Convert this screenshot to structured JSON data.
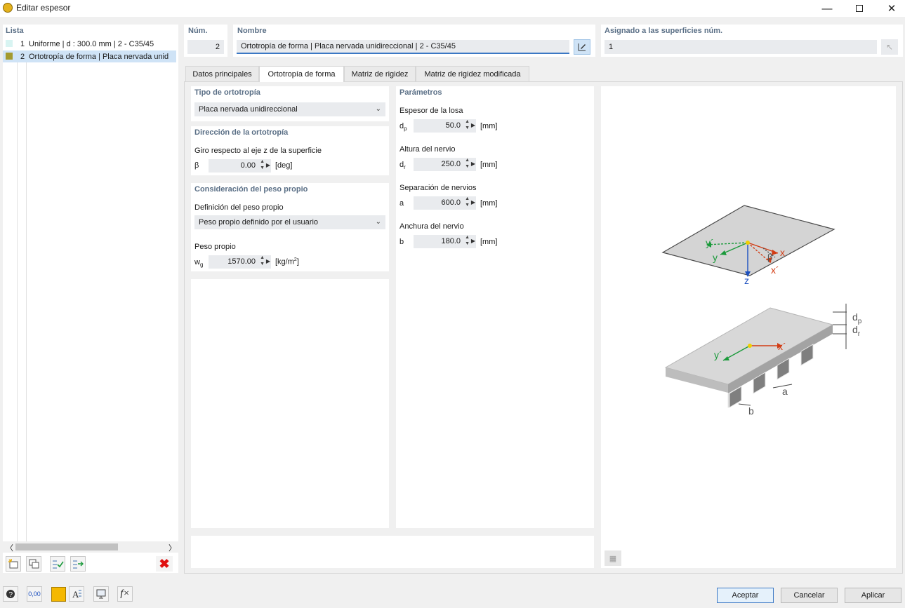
{
  "window": {
    "title": "Editar espesor"
  },
  "list": {
    "header": "Lista",
    "items": [
      {
        "num": "1",
        "text": "Uniforme | d : 300.0 mm | 2 - C35/45",
        "color": "#d8f4f2"
      },
      {
        "num": "2",
        "text": "Ortotropía de forma | Placa nervada unid",
        "color": "#a39a2e"
      }
    ]
  },
  "num": {
    "label": "Núm.",
    "value": "2"
  },
  "name": {
    "label": "Nombre",
    "value": "Ortotropía de forma | Placa nervada unidireccional | 2 - C35/45"
  },
  "assigned": {
    "label": "Asignado a las superficies núm.",
    "value": "1"
  },
  "tabs": [
    "Datos principales",
    "Ortotropía de forma",
    "Matriz de rigidez",
    "Matriz de rigidez modificada"
  ],
  "ortho_type": {
    "header": "Tipo de ortotropía",
    "value": "Placa nervada unidireccional"
  },
  "ortho_dir": {
    "header": "Dirección de la ortotropía",
    "label": "Giro respecto al eje z de la superficie",
    "symbol": "β",
    "value": "0.00",
    "unit": "[deg]"
  },
  "self_weight": {
    "header": "Consideración del peso propio",
    "def_label": "Definición del peso propio",
    "def_value": "Peso propio definido por el usuario",
    "weight_label": "Peso propio",
    "symbol": "w",
    "symbol_sub": "g",
    "value": "1570.00",
    "unit": "[kg/m",
    "unit_sup": "2",
    "unit_end": "]"
  },
  "params": {
    "header": "Parámetros",
    "items": [
      {
        "label": "Espesor de la losa",
        "symbol": "d",
        "sub": "p",
        "value": "50.0",
        "unit": "[mm]"
      },
      {
        "label": "Altura del nervio",
        "symbol": "d",
        "sub": "r",
        "value": "250.0",
        "unit": "[mm]"
      },
      {
        "label": "Separación de nervios",
        "symbol": "a",
        "sub": "",
        "value": "600.0",
        "unit": "[mm]"
      },
      {
        "label": "Anchura del nervio",
        "symbol": "b",
        "sub": "",
        "value": "180.0",
        "unit": "[mm]"
      }
    ]
  },
  "diagram": {
    "top": {
      "y_prime": "y´",
      "y": "y",
      "x": "x",
      "x_prime": "x´",
      "beta": "β",
      "z": "z"
    },
    "bottom": {
      "y_prime": "y´",
      "x_prime": "x´",
      "dp": "d",
      "dp_sub": "p",
      "dr": "d",
      "dr_sub": "r",
      "a": "a",
      "b": "b"
    }
  },
  "buttons": {
    "ok": "Aceptar",
    "cancel": "Cancelar",
    "apply": "Aplicar"
  },
  "bottom_toolbar": {
    "value_icon_text": "0,00"
  },
  "colors": {
    "accent": "#3b78c4",
    "header_text": "#5a6f86",
    "y_axis": "#1a9a3a",
    "x_axis": "#d23c14",
    "z_axis": "#1b4fbf",
    "origin": "#f0d000"
  }
}
